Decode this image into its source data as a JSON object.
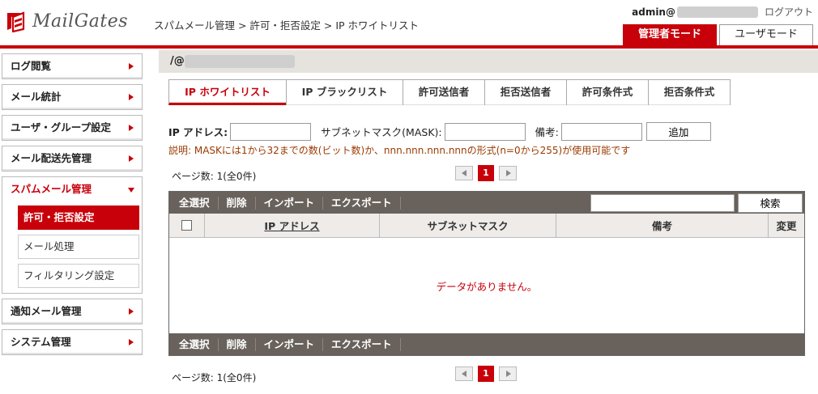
{
  "header": {
    "app_name": "MailGates",
    "breadcrumb": "スパムメール管理 > 許可・拒否設定 > IP ホワイトリスト",
    "user_prefix": "admin@",
    "logout_label": "ログアウト",
    "mode_admin": "管理者モード",
    "mode_user": "ユーザモード"
  },
  "sidebar": {
    "items": [
      {
        "label": "ログ閲覧"
      },
      {
        "label": "メール統計"
      },
      {
        "label": "ユーザ・グループ設定"
      },
      {
        "label": "メール配送先管理"
      },
      {
        "label": "スパムメール管理"
      },
      {
        "label": "通知メール管理"
      },
      {
        "label": "システム管理"
      }
    ],
    "sub_items": [
      {
        "label": "許可・拒否設定"
      },
      {
        "label": "メール処理"
      },
      {
        "label": "フィルタリング設定"
      }
    ]
  },
  "main": {
    "title_prefix": "/@",
    "tabs": [
      {
        "label": "IP ホワイトリスト"
      },
      {
        "label": "IP ブラックリスト"
      },
      {
        "label": "許可送信者"
      },
      {
        "label": "拒否送信者"
      },
      {
        "label": "許可条件式"
      },
      {
        "label": "拒否条件式"
      }
    ],
    "form": {
      "ip_label": "IP アドレス:",
      "ip_value": "",
      "mask_label": "サブネットマスク(MASK):",
      "mask_value": "",
      "note_label": "備考:",
      "note_value": "",
      "add_label": "追加"
    },
    "hint": "説明: MASKには1から32までの数(ビット数)か、nnn.nnn.nnn.nnnの形式(n=0から255)が使用可能です",
    "pager": {
      "info": "ページ数: 1(全0件)",
      "current": "1"
    },
    "toolbar": {
      "select_all": "全選択",
      "delete": "削除",
      "import": "インポート",
      "export": "エクスポート",
      "search_value": "",
      "search_label": "検索"
    },
    "table": {
      "columns": [
        "IP アドレス",
        "サブネットマスク",
        "備考",
        "変更"
      ],
      "empty_message": "データがありません。"
    }
  },
  "colors": {
    "accent": "#c8000a",
    "toolbar": "#69625c"
  }
}
